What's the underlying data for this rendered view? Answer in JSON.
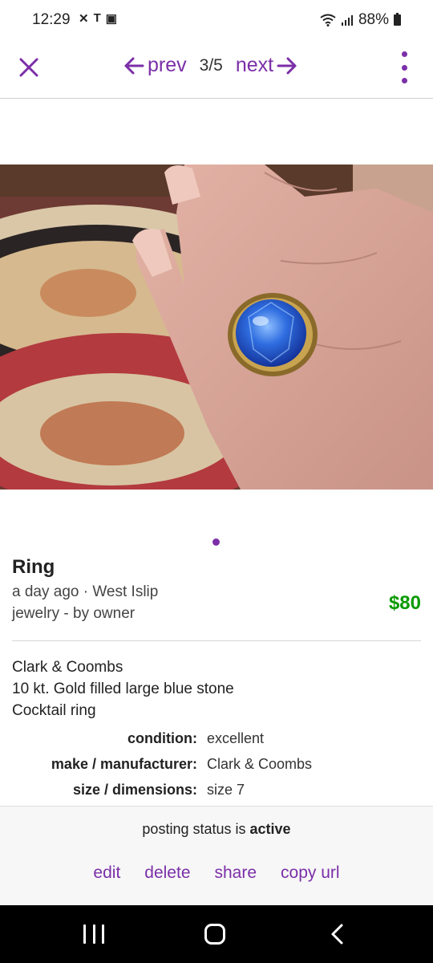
{
  "status_bar": {
    "time": "12:29",
    "left_icons": [
      "missed-call-icon",
      "t-mobile-icon",
      "image-icon"
    ],
    "battery": "88%"
  },
  "nav": {
    "prev_label": "prev",
    "count": "3/5",
    "next_label": "next"
  },
  "pagination": {
    "current_dot": 1,
    "dots": 1
  },
  "listing": {
    "title": "Ring",
    "posted": "a day ago · West Islip",
    "category": "jewelry - by owner",
    "price": "$80",
    "description": [
      "Clark & Coombs",
      "10 kt. Gold filled large blue stone",
      "Cocktail ring"
    ],
    "attributes": [
      {
        "key": "condition:",
        "value": "excellent"
      },
      {
        "key": "make / manufacturer:",
        "value": "Clark & Coombs"
      },
      {
        "key": "size / dimensions:",
        "value": "size 7"
      }
    ]
  },
  "footer": {
    "status_prefix": "posting status is",
    "status_value": "active",
    "actions": [
      "edit",
      "delete",
      "share",
      "copy url"
    ]
  },
  "colors": {
    "accent": "#7b2fa8",
    "price": "#0a9a00",
    "android_nav_bg": "#000000"
  }
}
